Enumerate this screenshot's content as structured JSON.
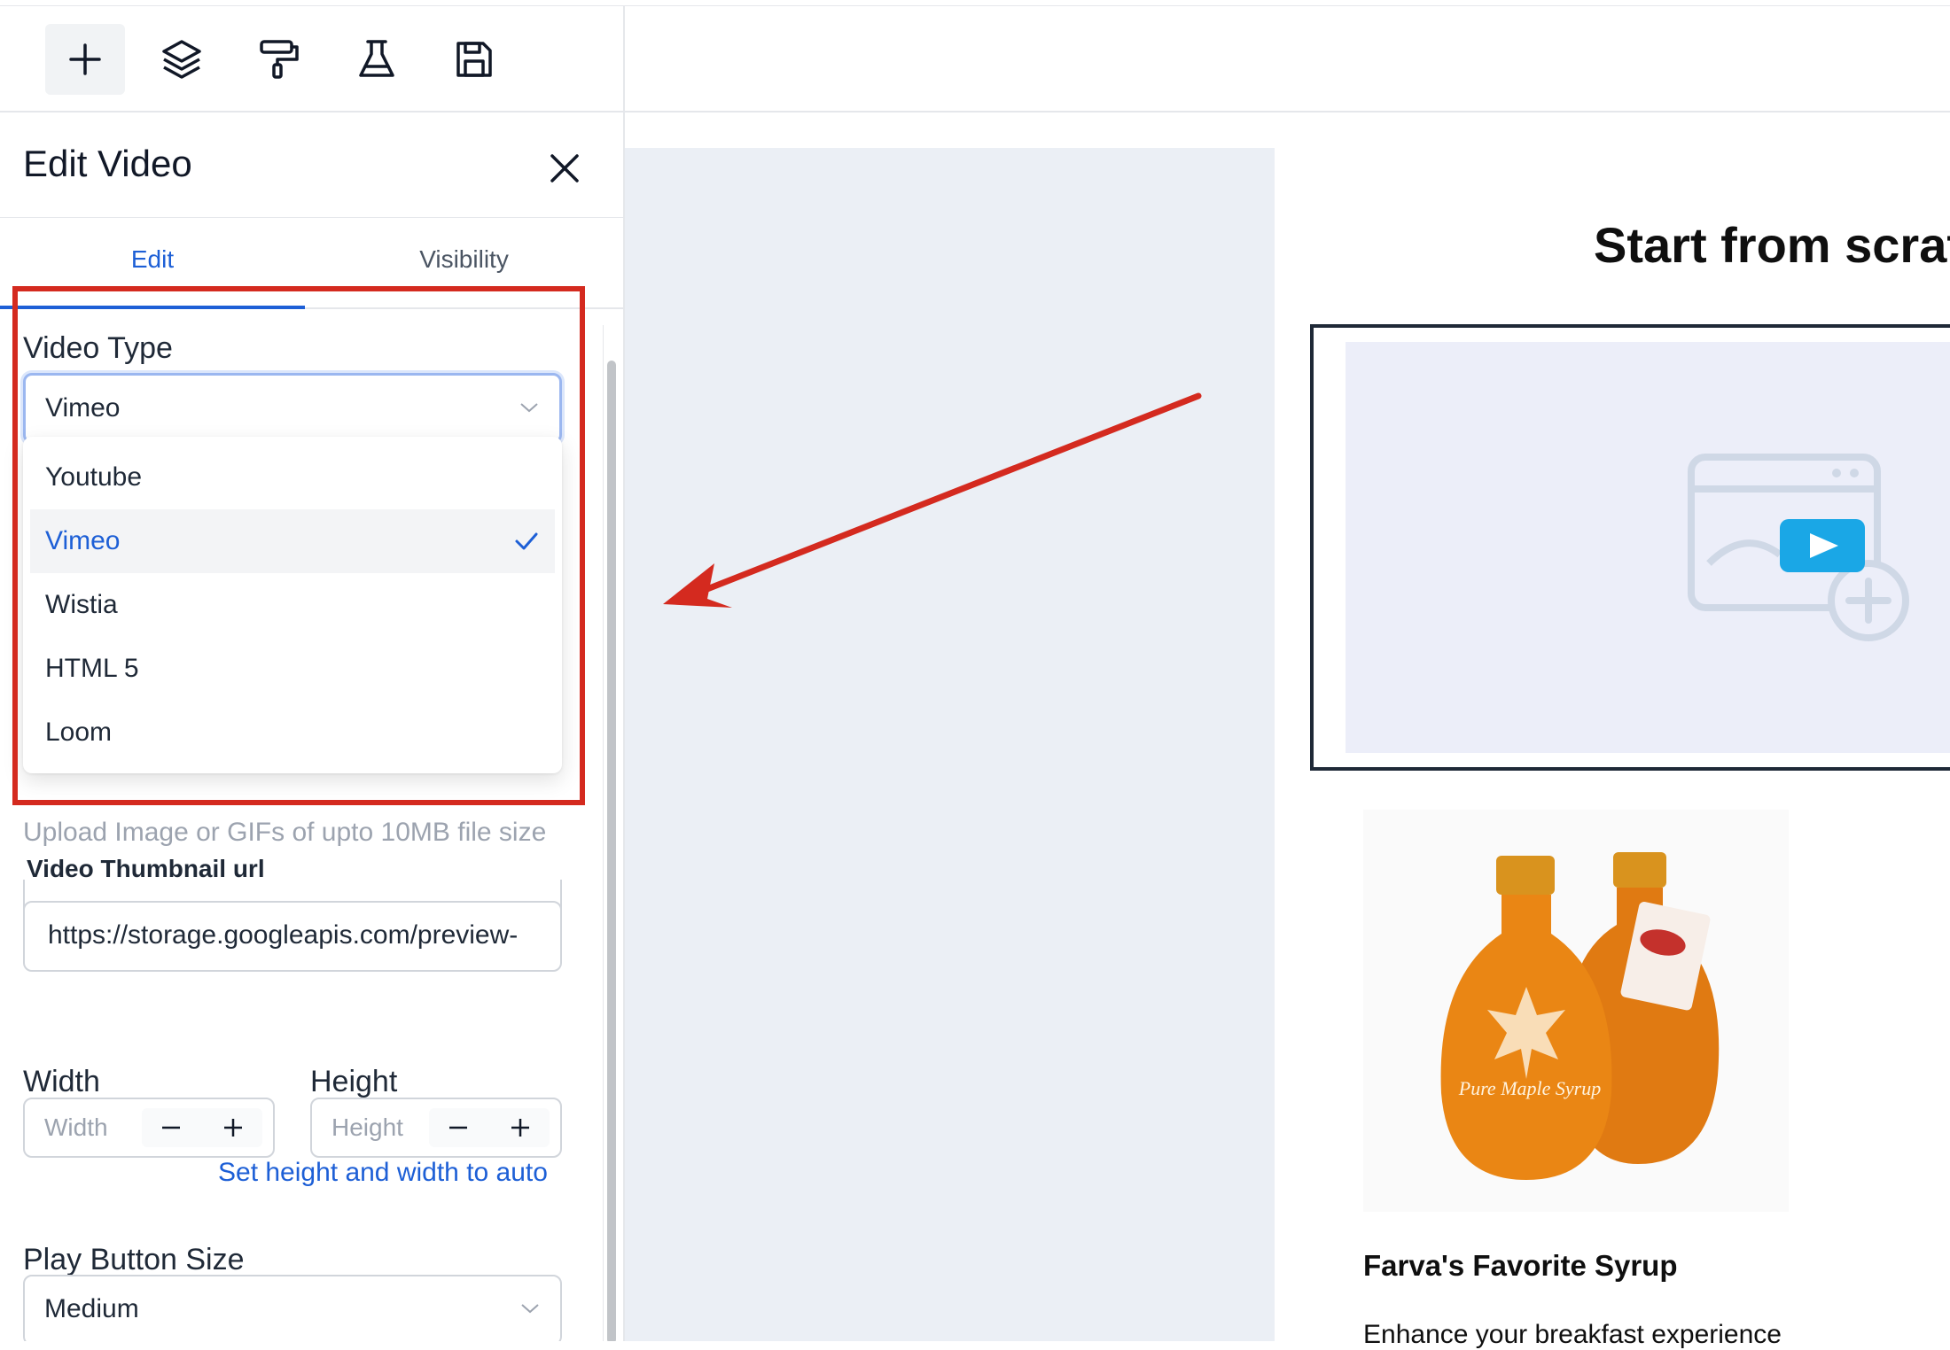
{
  "toolbar": {
    "buttons": [
      {
        "name": "add-icon"
      },
      {
        "name": "layers-icon"
      },
      {
        "name": "paint-roller-icon"
      },
      {
        "name": "flask-icon"
      },
      {
        "name": "save-icon"
      }
    ]
  },
  "panel": {
    "title": "Edit Video",
    "tabs": [
      {
        "label": "Edit",
        "active": true
      },
      {
        "label": "Visibility",
        "active": false
      }
    ],
    "video_type": {
      "label": "Video Type",
      "value": "Vimeo",
      "options": [
        {
          "label": "Youtube",
          "selected": false
        },
        {
          "label": "Vimeo",
          "selected": true
        },
        {
          "label": "Wistia",
          "selected": false
        },
        {
          "label": "HTML 5",
          "selected": false
        },
        {
          "label": "Loom",
          "selected": false
        }
      ]
    },
    "upload_hint": "Upload Image or GIFs of upto 10MB file size",
    "thumbnail": {
      "label": "Video Thumbnail url",
      "value": "https://storage.googleapis.com/preview-"
    },
    "width": {
      "label": "Width",
      "placeholder": "Width"
    },
    "height": {
      "label": "Height",
      "placeholder": "Height"
    },
    "auto_link": "Set height and width to auto",
    "play_button_size": {
      "label": "Play Button Size",
      "value": "Medium"
    }
  },
  "canvas": {
    "page_title": "Start from scrat",
    "product": {
      "title": "Farva's Favorite Syrup",
      "description": "Enhance your breakfast experience",
      "image_text": "Pure Maple Syrup"
    }
  },
  "colors": {
    "accent": "#1d5fd6",
    "highlight": "#d42a1f",
    "canvas_bg": "#ebeff5",
    "play_button": "#1aa7e6"
  }
}
